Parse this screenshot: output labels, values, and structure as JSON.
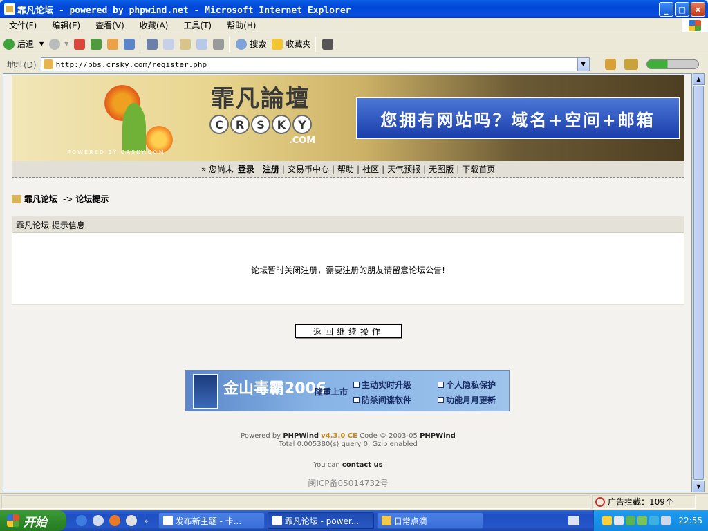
{
  "window": {
    "title": "霏凡论坛 - powered by phpwind.net - Microsoft Internet Explorer",
    "controls": {
      "minimize": "_",
      "maximize": "□",
      "close": "×"
    }
  },
  "menu": [
    "文件(F)",
    "编辑(E)",
    "查看(V)",
    "收藏(A)",
    "工具(T)",
    "帮助(H)"
  ],
  "toolbar": {
    "back": "后退",
    "search": "搜索",
    "favorites": "收藏夹"
  },
  "address": {
    "label": "地址(D)",
    "url": "http://bbs.crsky.com/register.php"
  },
  "banner": {
    "logo_cn": "霏凡論壇",
    "logo_letters": [
      "C",
      "R",
      "S",
      "K",
      "Y"
    ],
    "logo_com": ".COM",
    "powered": "POWERED BY CRSKY.COM",
    "ad_text": "您拥有网站吗？域名+空间+邮箱"
  },
  "nav": {
    "prefix": "» 您尚未",
    "login": "登录",
    "register": "注册",
    "links": [
      "交易币中心",
      "帮助",
      "社区",
      "天气预报",
      "无图版",
      "下载首页"
    ]
  },
  "breadcrumb": {
    "forum": "霏凡论坛",
    "arrow": "->",
    "page": "论坛提示"
  },
  "panel": {
    "heading": "霏凡论坛 提示信息",
    "message": "论坛暂时关闭注册，需要注册的朋友请留意论坛公告!"
  },
  "back_button": "返回继续操作",
  "ad2": {
    "brand": "金山毒霸2006",
    "tag": "隆重上市",
    "features": [
      "主动实时升级",
      "个人隐私保护",
      "防杀间谍软件",
      "功能月月更新"
    ]
  },
  "footer": {
    "powered_prefix": "Powered by",
    "product": "PHPWind",
    "version": "v4.3.0 CE",
    "code": "Code © 2003-05",
    "product2": "PHPWind",
    "stats": "Total 0.005380(s) query 0, Gzip enabled",
    "contact_prefix": "You can",
    "contact_link": "contact us",
    "icp": "闽ICP备05014732号"
  },
  "status": {
    "popup_block": "广告拦截：109个"
  },
  "taskbar": {
    "start": "开始",
    "tasks": [
      "发布新主题 - 卡...",
      "霏凡论坛 - power...",
      "日常点滴"
    ],
    "clock": "22:55"
  },
  "colors": {
    "titlebar": "#0a4fe0",
    "start": "#2f8a2b",
    "taskbar": "#2457c9",
    "version": "#c58a1a"
  }
}
